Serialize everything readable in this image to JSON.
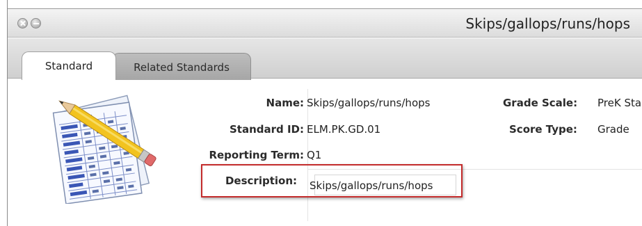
{
  "window": {
    "title": "Skips/gallops/runs/hops"
  },
  "tabs": [
    {
      "label": "Standard",
      "active": true
    },
    {
      "label": "Related Standards",
      "active": false
    }
  ],
  "icons": {
    "close": "close-icon",
    "minimize": "minimize-icon",
    "grade_sheet": "grade-sheet-pencil-icon"
  },
  "fields": {
    "name": {
      "label": "Name:",
      "value": "Skips/gallops/runs/hops"
    },
    "standard_id": {
      "label": "Standard ID:",
      "value": "ELM.PK.GD.01"
    },
    "reporting_term": {
      "label": "Reporting Term:",
      "value": "Q1"
    },
    "description": {
      "label": "Description:",
      "value": "Skips/gallops/runs/hops"
    },
    "grade_scale": {
      "label": "Grade Scale:",
      "value": "PreK Sta"
    },
    "score_type": {
      "label": "Score Type:",
      "value": "Grade"
    }
  },
  "colors": {
    "highlight_border": "#c32b2b",
    "inactive_tab": "#a6a6a6"
  }
}
